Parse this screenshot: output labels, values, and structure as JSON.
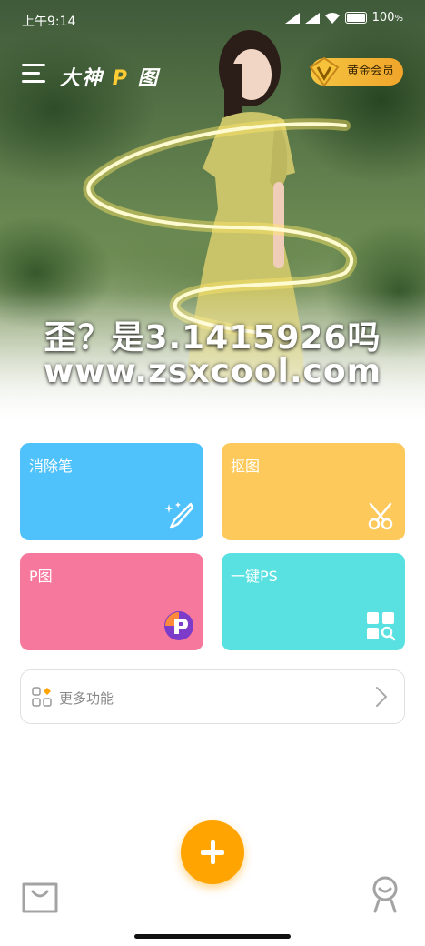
{
  "status_bar": {
    "time": "上午9:14",
    "battery": "100"
  },
  "header": {
    "app_title_prefix": "大神",
    "app_title_p": "P",
    "app_title_suffix": "图",
    "vip_label": "黄金会员"
  },
  "hero": {
    "watermark_line1": "歪？是3.1415926吗",
    "watermark_line2": "www.zsxcool.com"
  },
  "tiles": [
    {
      "label": "消除笔",
      "color": "#4fc1fb",
      "icon": "magic-brush-icon"
    },
    {
      "label": "抠图",
      "color": "#fdc95a",
      "icon": "scissors-icon"
    },
    {
      "label": "P图",
      "color": "#f7789d",
      "icon": "p-logo-icon"
    },
    {
      "label": "一键PS",
      "color": "#59e0e0",
      "icon": "grid-search-icon"
    }
  ],
  "more": {
    "label": "更多功能"
  },
  "colors": {
    "accent": "#ffa400",
    "vip_gold": "#f5c542"
  }
}
